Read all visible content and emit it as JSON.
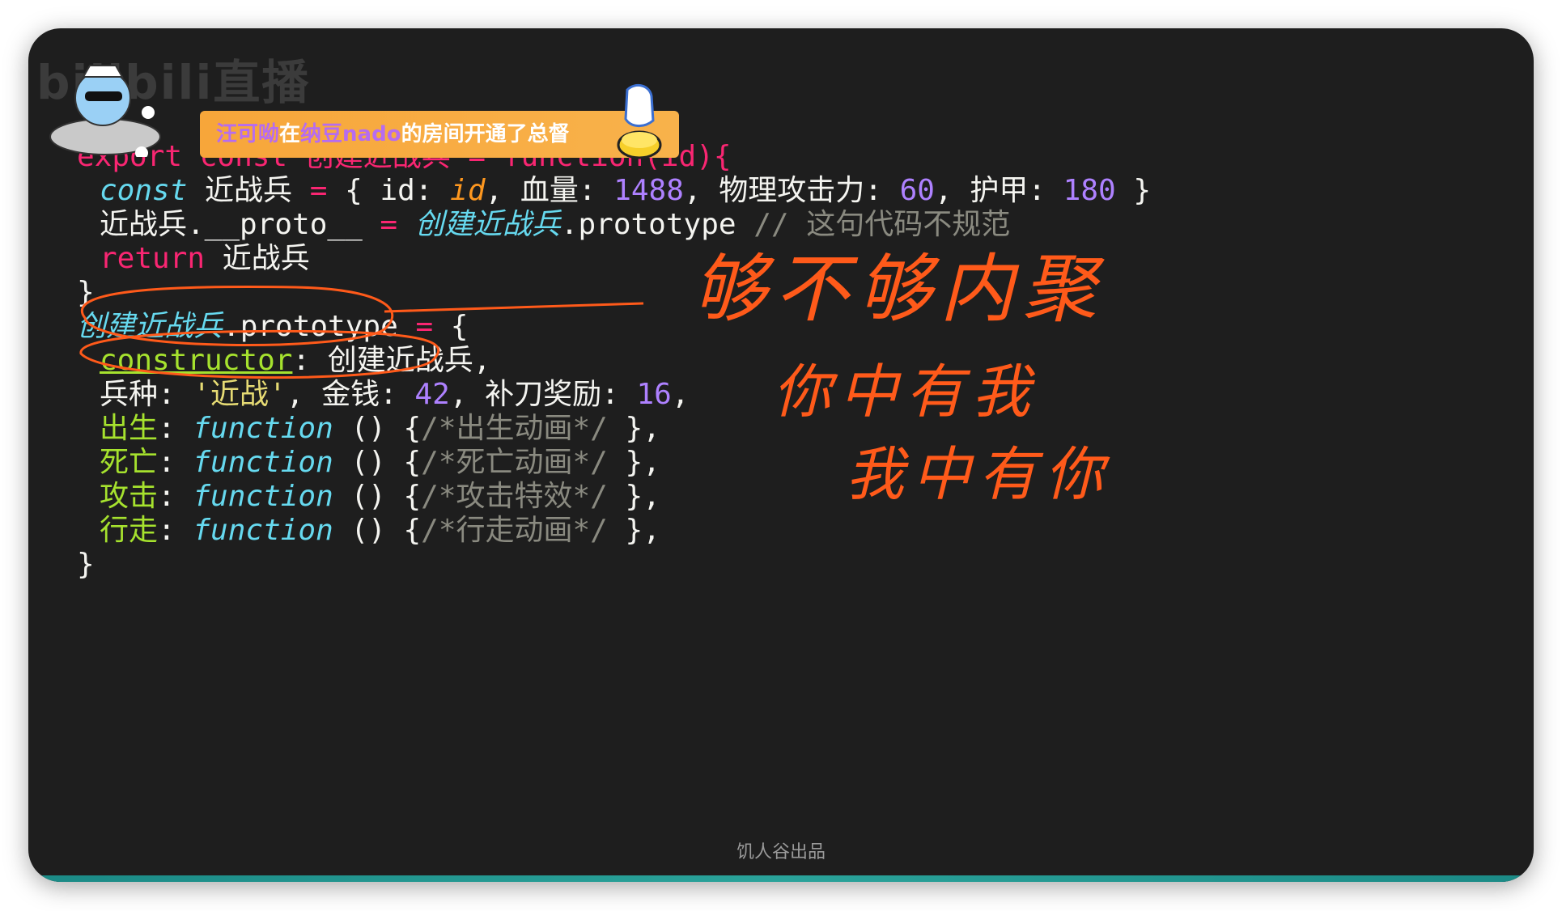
{
  "watermark": "bilibili直播",
  "notification": {
    "user": "汪可呦",
    "mid1": "在",
    "host": "纳豆nado",
    "rest": "的房间开通了总督"
  },
  "code": {
    "l0": "export const 创建近战兵 = function(id){",
    "l1_kw": "const",
    "l1_var": " 近战兵 ",
    "l1_eq": "=",
    "l1_a": " { id: ",
    "l1_id": "id",
    "l1_b": ", 血量: ",
    "l1_hp": "1488",
    "l1_c": ", 物理攻击力: ",
    "l1_atk": "60",
    "l1_d": ", 护甲: ",
    "l1_armor": "180",
    "l1_e": " }",
    "l2_a": "近战兵.__proto__ ",
    "l2_eq": "=",
    "l2_cls": " 创建近战兵",
    "l2_b": ".prototype ",
    "l2_cmt": "// 这句代码不规范",
    "l3_kw": "return",
    "l3_b": " 近战兵",
    "l4": "}",
    "l5_cls": "创建近战兵",
    "l5_b": ".prototype ",
    "l5_eq": "=",
    "l5_c": " {",
    "l6_prop": "constructor",
    "l6_b": ": 创建近战兵,",
    "l7_a": "兵种: ",
    "l7_str": "'近战'",
    "l7_b": ", 金钱: ",
    "l7_gold": "42",
    "l7_c": ", 补刀奖励: ",
    "l7_bonus": "16",
    "l7_d": ",",
    "l8_prop": "出生",
    "l8_fn": "function",
    "l8_b": " () {",
    "l8_cmt": "/*出生动画*/",
    "l8_c": " },",
    "l9_prop": "死亡",
    "l9_fn": "function",
    "l9_b": " () {",
    "l9_cmt": "/*死亡动画*/",
    "l9_c": " },",
    "l10_prop": "攻击",
    "l10_fn": "function",
    "l10_b": " () {",
    "l10_cmt": "/*攻击特效*/",
    "l10_c": " },",
    "l11_prop": "行走",
    "l11_fn": "function",
    "l11_b": " () {",
    "l11_cmt": "/*行走动画*/",
    "l11_c": " },",
    "l12": "}"
  },
  "annotations": {
    "line1": "够不够内聚",
    "line2": "你中有我",
    "line3": "我中有你"
  },
  "footer": "饥人谷出品",
  "colors": {
    "background": "#1e1e1e",
    "annotation": "#ff5a1a",
    "banner": "#f7a63a"
  }
}
